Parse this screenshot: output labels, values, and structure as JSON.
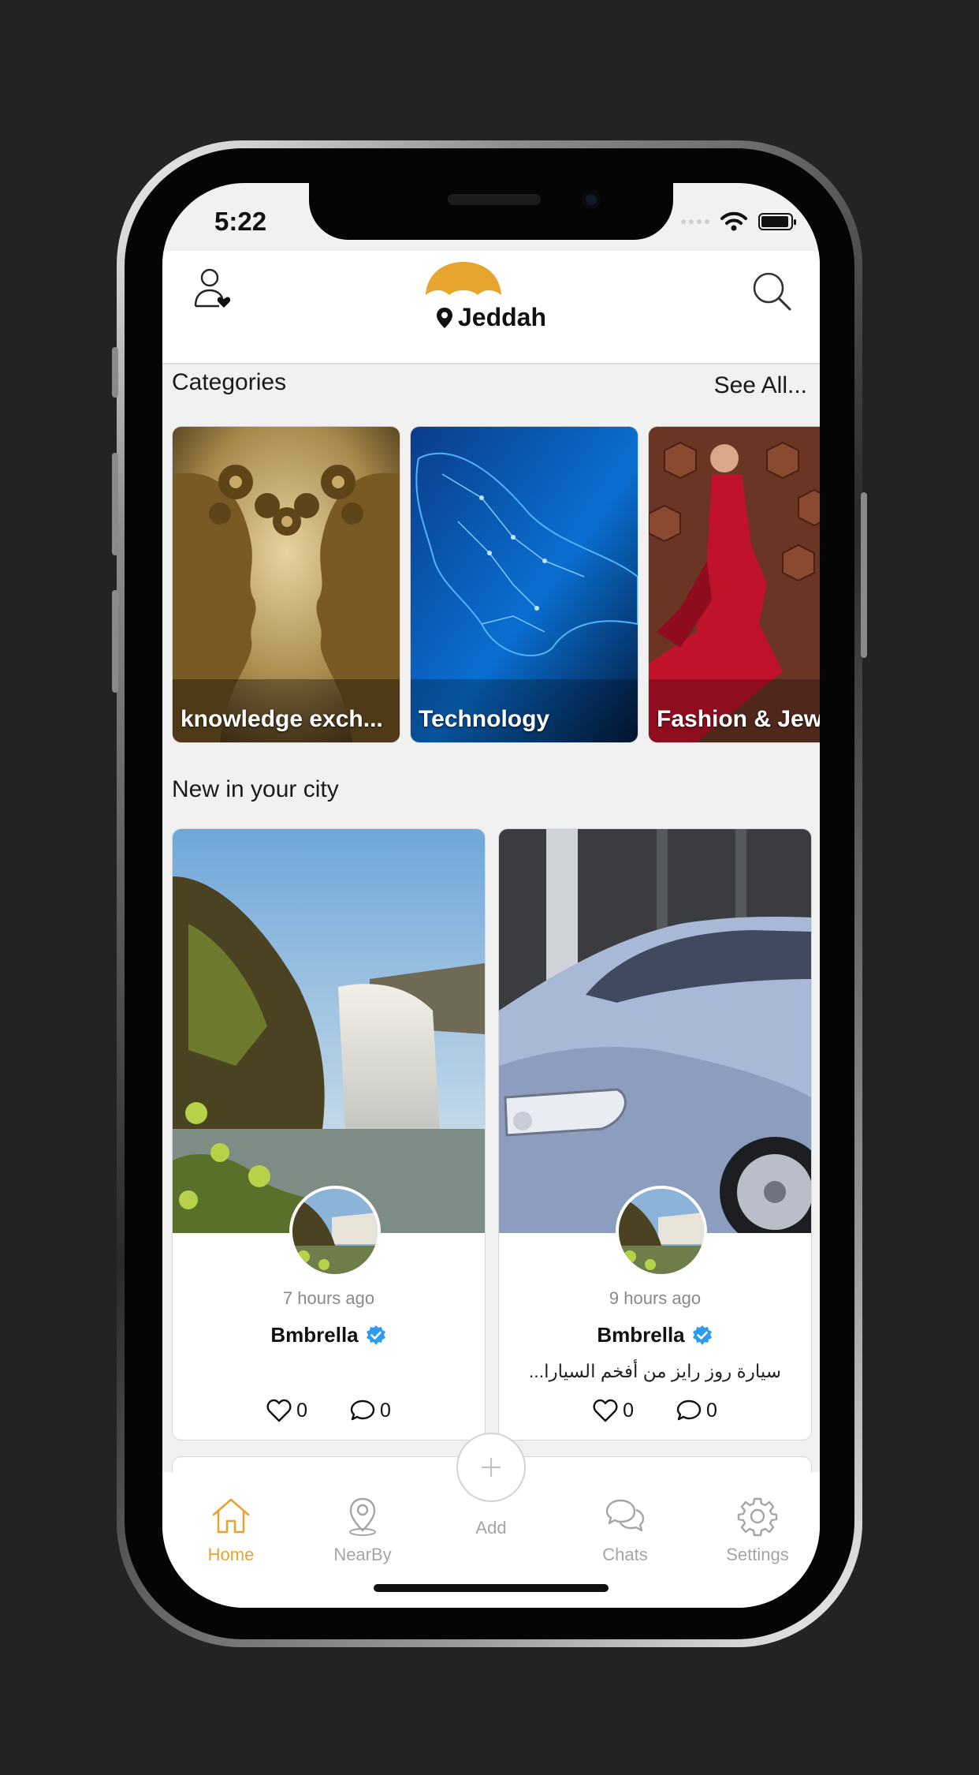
{
  "status_bar": {
    "time": "5:22"
  },
  "header": {
    "city": "Jeddah"
  },
  "categories": {
    "title": "Categories",
    "see_all": "See All...",
    "items": [
      {
        "label": "knowledge exch..."
      },
      {
        "label": "Technology"
      },
      {
        "label": "Fashion & Jew"
      }
    ]
  },
  "new_in_city": {
    "title": "New in your city",
    "posts": [
      {
        "time": "7 hours ago",
        "user": "Bmbrella",
        "description": "",
        "likes": "0",
        "comments": "0"
      },
      {
        "time": "9 hours ago",
        "user": "Bmbrella",
        "description": "سيارة روز رايز من أفخم السيارا...",
        "likes": "0",
        "comments": "0"
      }
    ]
  },
  "tabbar": {
    "home": "Home",
    "nearby": "NearBy",
    "add": "Add",
    "chats": "Chats",
    "settings": "Settings"
  },
  "colors": {
    "accent": "#e5a52f",
    "verified": "#2d9cf0",
    "inactive": "#a5a5a5"
  }
}
